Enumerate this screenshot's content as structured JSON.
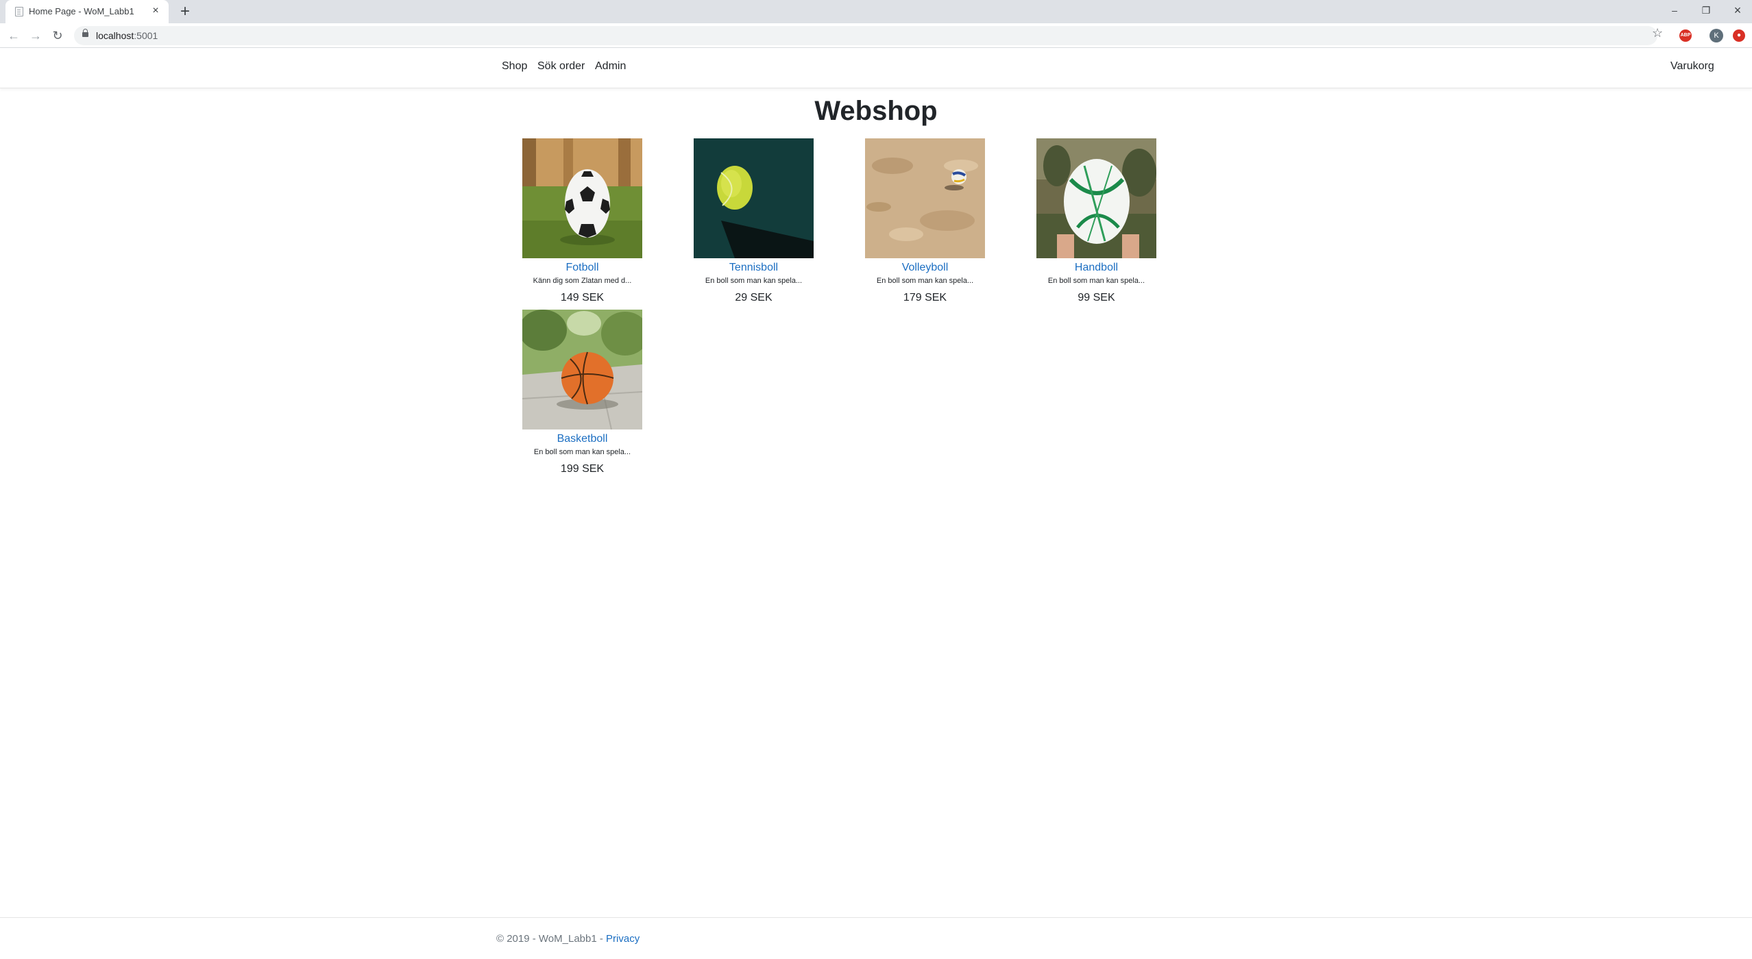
{
  "browser": {
    "tab_title": "Home Page - WoM_Labb1",
    "tab_close": "×",
    "new_tab": "+",
    "url_host": "localhost",
    "url_port": ":5001",
    "window": {
      "minimize": "–",
      "maximize": "❐",
      "close": "×"
    },
    "avatar_initial": "K"
  },
  "nav": {
    "links": [
      "Shop",
      "Sök order",
      "Admin"
    ],
    "cart": "Varukorg"
  },
  "main": {
    "heading": "Webshop",
    "products": [
      {
        "name": "Fotboll",
        "desc": "Känn dig som Zlatan med d...",
        "price": "149 SEK"
      },
      {
        "name": "Tennisboll",
        "desc": "En boll som man kan spela...",
        "price": "29 SEK"
      },
      {
        "name": "Volleyboll",
        "desc": "En boll som man kan spela...",
        "price": "179 SEK"
      },
      {
        "name": "Handboll",
        "desc": "En boll som man kan spela...",
        "price": "99 SEK"
      },
      {
        "name": "Basketboll",
        "desc": "En boll som man kan spela...",
        "price": "199 SEK"
      }
    ]
  },
  "footer": {
    "copyright": "© 2019 - WoM_Labb1 - ",
    "privacy": "Privacy"
  }
}
